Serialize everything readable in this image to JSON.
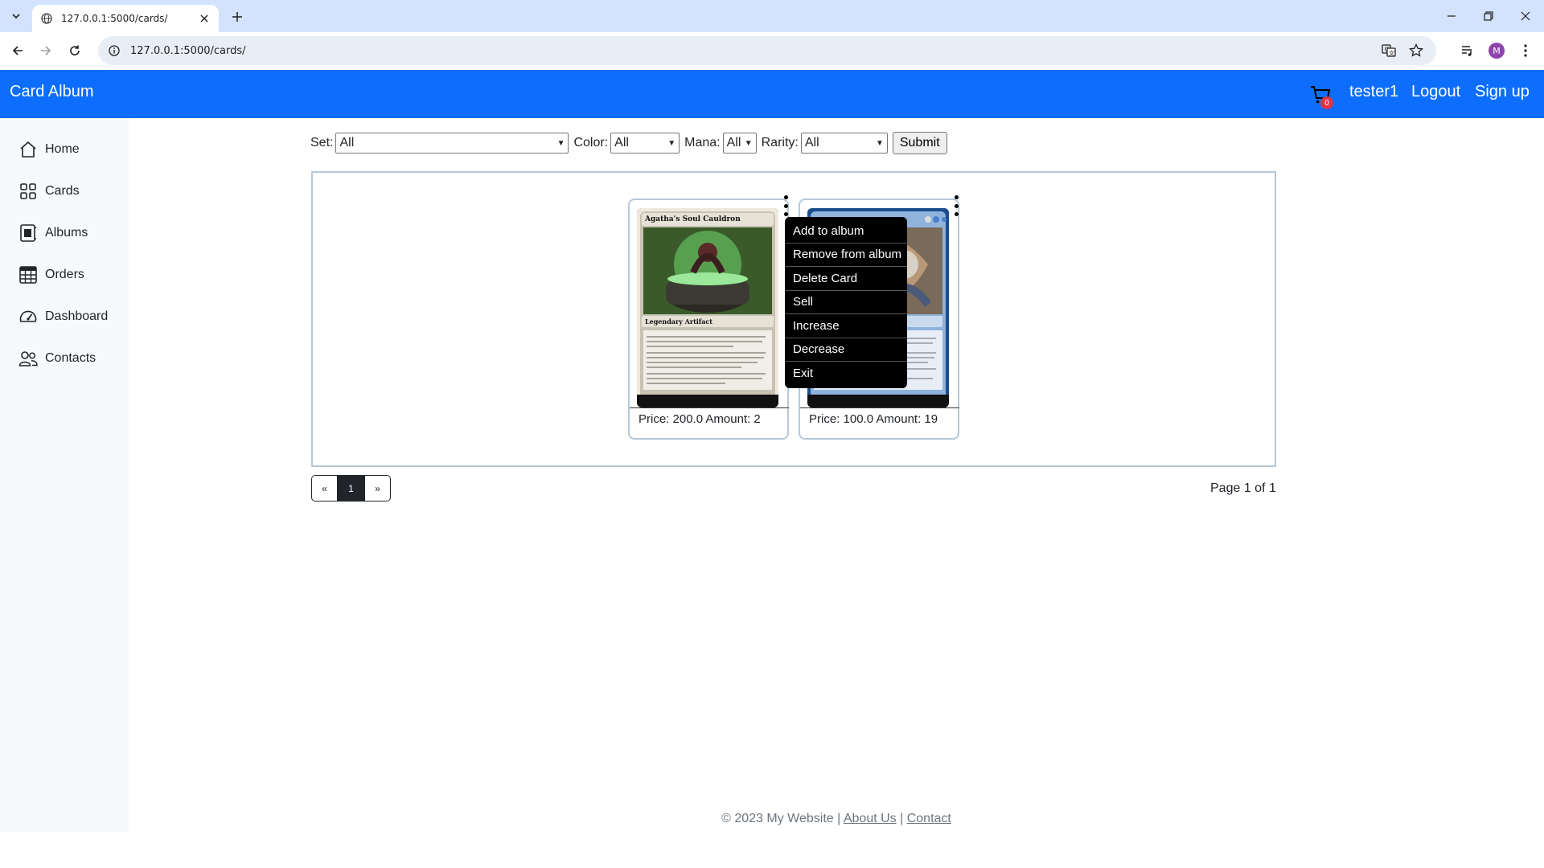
{
  "browser": {
    "tab_title": "127.0.0.1:5000/cards/",
    "url": "127.0.0.1:5000/cards/",
    "profile_initial": "M"
  },
  "navbar": {
    "brand": "Card Album",
    "cart_count": "0",
    "user": "tester1",
    "logout": "Logout",
    "signup": "Sign up"
  },
  "sidebar": {
    "items": [
      {
        "label": "Home",
        "icon": "home-icon"
      },
      {
        "label": "Cards",
        "icon": "grid-icon"
      },
      {
        "label": "Albums",
        "icon": "album-icon"
      },
      {
        "label": "Orders",
        "icon": "table-icon"
      },
      {
        "label": "Dashboard",
        "icon": "speedometer-icon"
      },
      {
        "label": "Contacts",
        "icon": "people-icon"
      }
    ]
  },
  "filters": {
    "set_label": "Set:",
    "set_value": "All",
    "color_label": "Color:",
    "color_value": "All",
    "mana_label": "Mana:",
    "mana_value": "All",
    "rarity_label": "Rarity:",
    "rarity_value": "All",
    "submit": "Submit"
  },
  "cards": [
    {
      "name": "Agatha's Soul Cauldron",
      "type": "Legendary Artifact",
      "price_text": "Price: 200.0 Amount: 2"
    },
    {
      "name": "",
      "type": "",
      "price_text": "Price: 100.0 Amount: 19"
    }
  ],
  "context_menu": {
    "items": [
      "Add to album",
      "Remove from album",
      "Delete Card",
      "Sell",
      "Increase",
      "Decrease",
      "Exit"
    ]
  },
  "pagination": {
    "prev": "«",
    "current": "1",
    "next": "»",
    "info": "Page 1 of 1"
  },
  "footer": {
    "copyright": "© 2023 My Website |",
    "about": "About Us",
    "separator": "|",
    "contact": "Contact"
  },
  "colors": {
    "navbar": "#0d6efd",
    "sidebar": "#f8f9fa",
    "menu_bg": "#000000",
    "badge": "#dc3545"
  }
}
